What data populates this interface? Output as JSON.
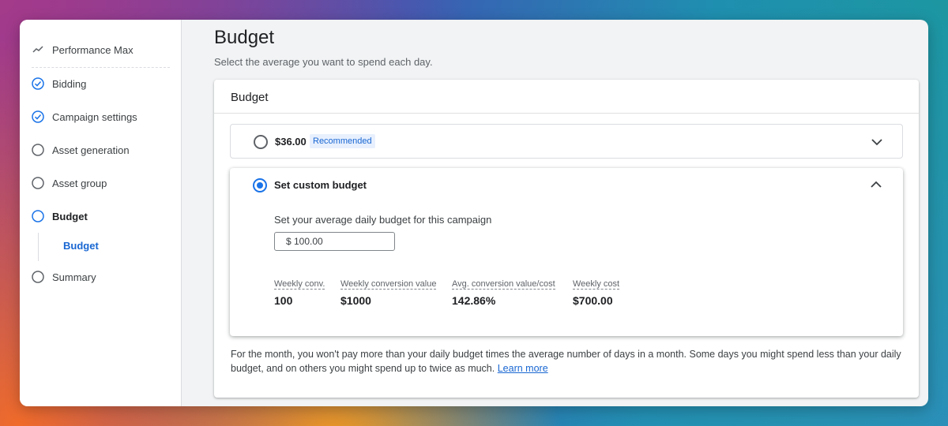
{
  "sidebar": {
    "items": [
      {
        "label": "Performance Max",
        "icon": "trend-icon",
        "state": "header"
      },
      {
        "label": "Bidding",
        "icon": "check-circle-icon",
        "state": "done"
      },
      {
        "label": "Campaign settings",
        "icon": "check-circle-icon",
        "state": "done"
      },
      {
        "label": "Asset generation",
        "icon": "circle-icon",
        "state": "todo"
      },
      {
        "label": "Asset group",
        "icon": "circle-icon",
        "state": "todo"
      },
      {
        "label": "Budget",
        "icon": "circle-icon",
        "state": "current"
      },
      {
        "label": "Summary",
        "icon": "circle-icon",
        "state": "todo"
      }
    ],
    "sub_item": "Budget"
  },
  "main": {
    "title": "Budget",
    "subtitle": "Select the average you want to spend each day."
  },
  "card": {
    "title": "Budget",
    "option1": {
      "label": "$36.00",
      "badge": "Recommended",
      "selected": false
    },
    "option2": {
      "label": "Set custom budget",
      "selected": true,
      "help": "Set your average daily budget for this campaign",
      "input_value": "$ 100.00",
      "metrics": [
        {
          "label": "Weekly conv.",
          "value": "100"
        },
        {
          "label": "Weekly conversion value",
          "value": "$1000"
        },
        {
          "label": "Avg. conversion value/cost",
          "value": "142.86%"
        },
        {
          "label": "Weekly cost",
          "value": "$700.00"
        }
      ]
    },
    "footnote": "For the month, you won't pay more than your daily budget times the average number of days in a month. Some days you might spend less than your daily budget, and on others you might spend up to twice as much.",
    "learn_more": "Learn more"
  },
  "colors": {
    "accent": "#1a73e8",
    "link": "#1967d2"
  }
}
